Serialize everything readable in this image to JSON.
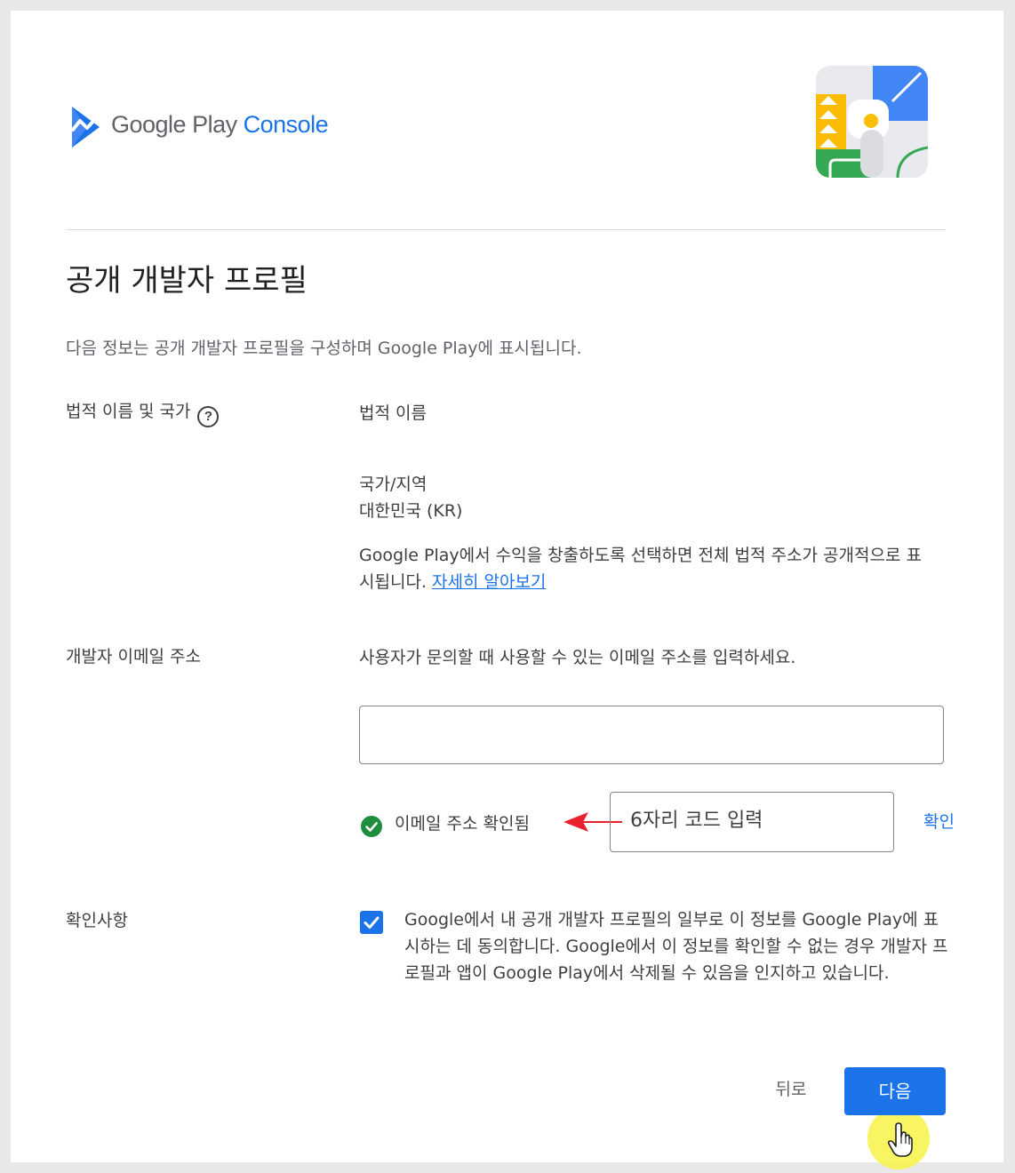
{
  "header": {
    "brand_google_play": "Google Play",
    "brand_console": "Console",
    "logo_icon": "play-console-logo-icon",
    "illustration_icon": "developer-profile-illustration"
  },
  "page": {
    "title": "공개 개발자 프로필",
    "intro": "다음 정보는 공개 개발자 프로필을 구성하며 Google Play에 표시됩니다."
  },
  "legal": {
    "label": "법적 이름 및 국가",
    "help_icon": "help-icon",
    "name_label": "법적 이름",
    "country_label": "국가/지역",
    "country_value": "대한민국 (KR)",
    "note": "Google Play에서 수익을 창출하도록 선택하면 전체 법적 주소가 공개적으로 표시됩니다.",
    "learn_more": "자세히 알아보기"
  },
  "email": {
    "label": "개발자 이메일 주소",
    "description": "사용자가 문의할 때 사용할 수 있는 이메일 주소를 입력하세요.",
    "value": "",
    "verified_text": "이메일 주소 확인됨",
    "code_placeholder": "6자리 코드 입력",
    "confirm_label": "확인"
  },
  "consent": {
    "label": "확인사항",
    "checked": true,
    "text": "Google에서 내 공개 개발자 프로필의 일부로 이 정보를 Google Play에 표시하는 데 동의합니다. Google에서 이 정보를 확인할 수 없는 경우 개발자 프로필과 앱이 Google Play에서 삭제될 수 있음을 인지하고 있습니다."
  },
  "footer": {
    "back_label": "뒤로",
    "next_label": "다음"
  },
  "colors": {
    "accent": "#1a73e8",
    "success": "#1e8e3e",
    "annotation_arrow": "#e8212f",
    "cursor_highlight": "#f8f346"
  }
}
